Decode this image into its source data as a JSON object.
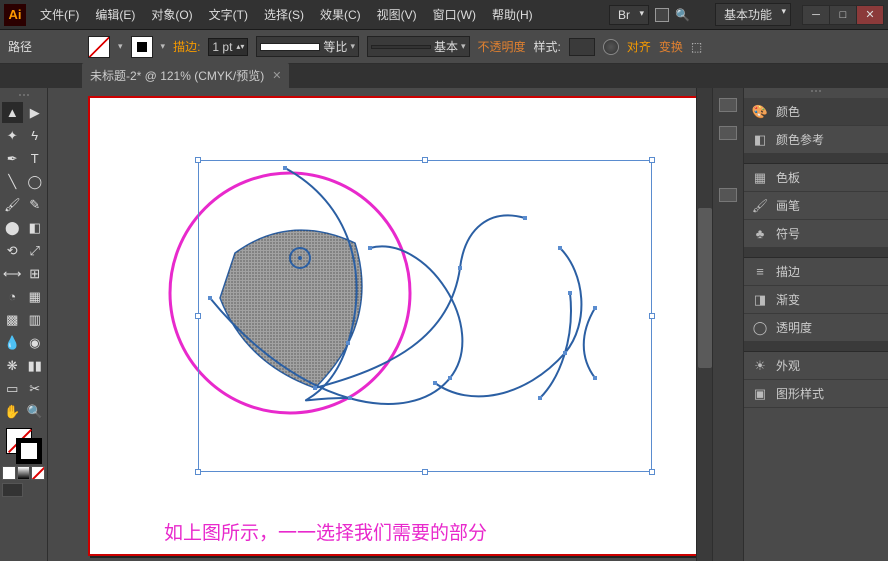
{
  "menus": {
    "file": "文件(F)",
    "edit": "编辑(E)",
    "object": "对象(O)",
    "type": "文字(T)",
    "select": "选择(S)",
    "effect": "效果(C)",
    "view": "视图(V)",
    "window": "窗口(W)",
    "help": "帮助(H)"
  },
  "title_right": {
    "br": "Br",
    "workspace": "基本功能"
  },
  "control": {
    "path_label": "路径",
    "stroke_label": "描边:",
    "stroke_value": "1 pt",
    "prof1": "等比",
    "prof2": "基本",
    "opacity_label": "不透明度",
    "style_label": "样式:",
    "align_label": "对齐",
    "transform_label": "变换"
  },
  "tab": {
    "title": "未标题-2* @ 121% (CMYK/预览)"
  },
  "panels": {
    "color": "颜色",
    "color_guide": "颜色参考",
    "swatches": "色板",
    "brushes": "画笔",
    "symbols": "符号",
    "stroke": "描边",
    "gradient": "渐变",
    "transparency": "透明度",
    "appearance": "外观",
    "graphic_styles": "图形样式"
  },
  "canvas": {
    "caption": "如上图所示，一一选择我们需要的部分"
  }
}
